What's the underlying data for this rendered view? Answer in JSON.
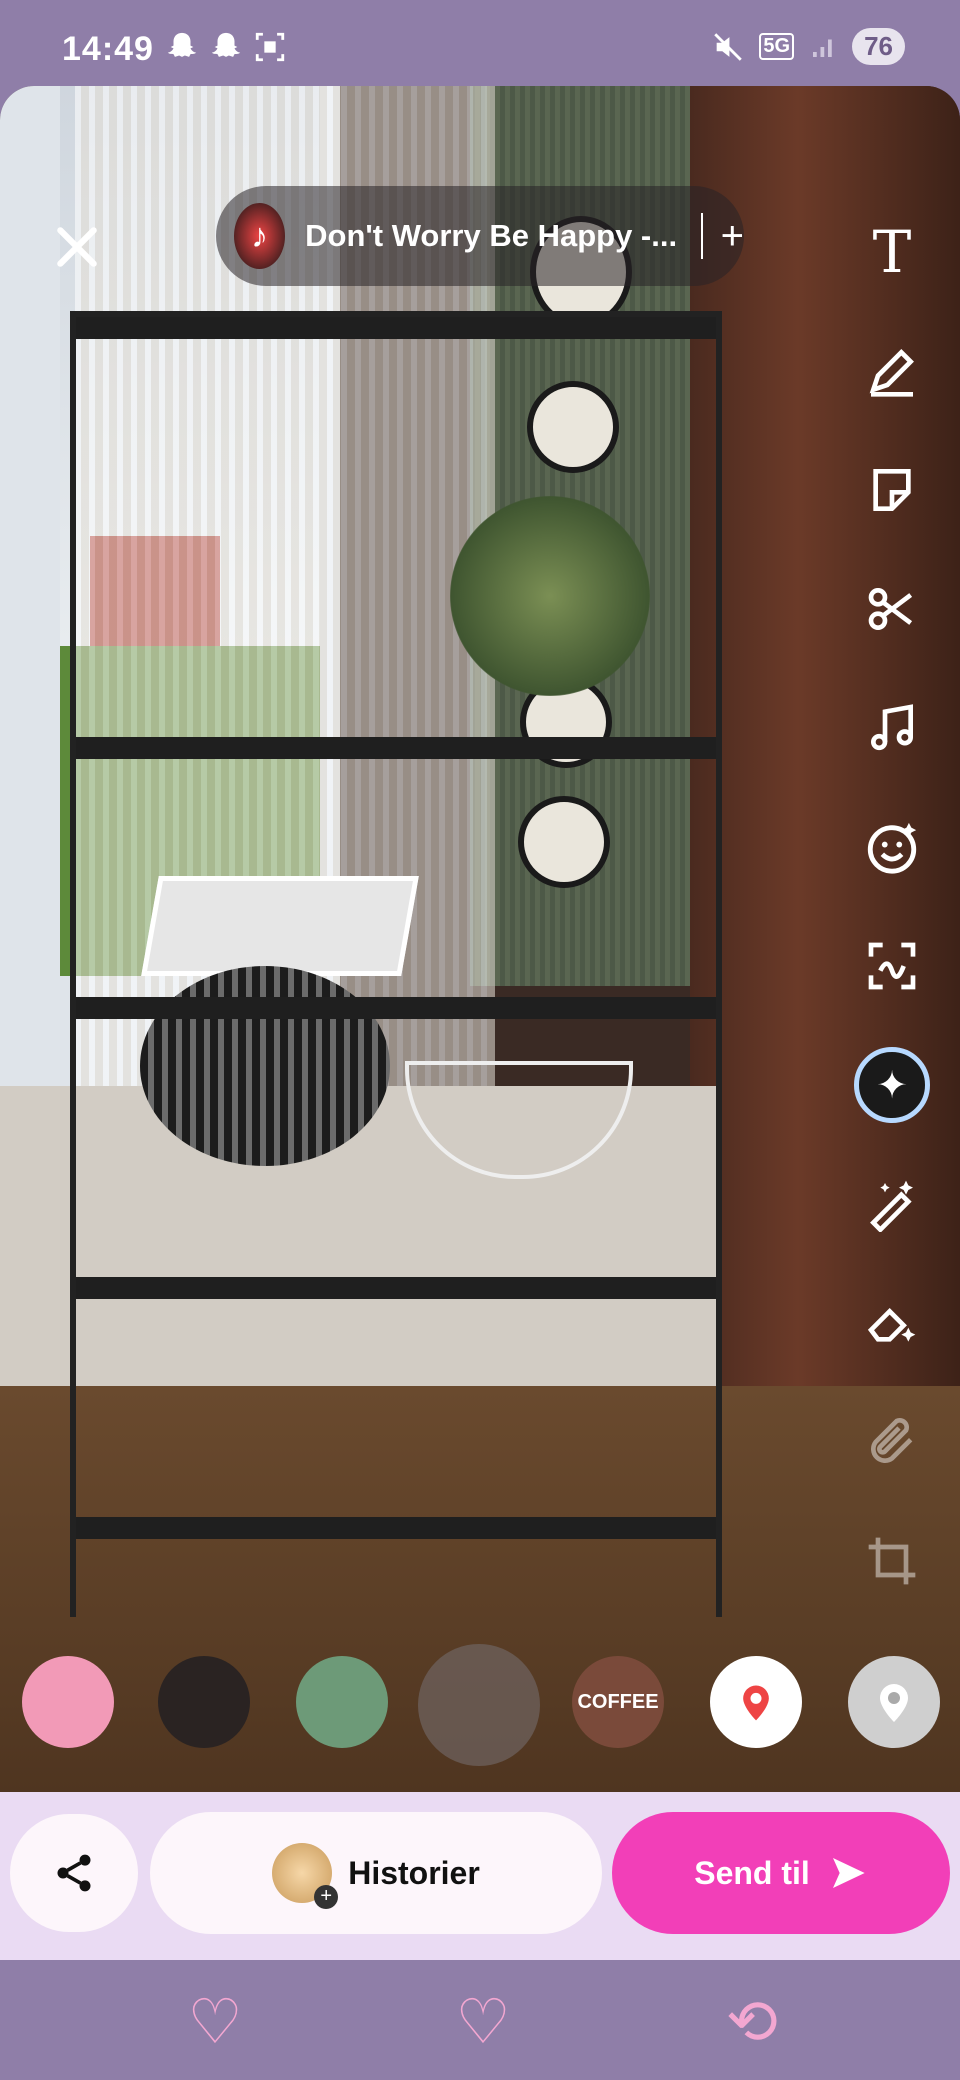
{
  "status_bar": {
    "time": "14:49",
    "left_icons": [
      "snapchat-ghost-icon",
      "snapchat-ghost-icon",
      "screenshot-icon"
    ],
    "right_icons": [
      "mute-icon",
      "5g-icon",
      "signal-icon"
    ],
    "battery": "76"
  },
  "editor": {
    "music": {
      "title": "Don't Worry Be Happy -...",
      "add": "+"
    },
    "close_icon": "close-icon",
    "tools": [
      "text-icon",
      "pen-icon",
      "sticker-icon",
      "scissors-icon",
      "music-icon",
      "lens-smiley-icon",
      "scan-icon",
      "ai-sparkle-icon",
      "magic-wand-icon",
      "eraser-sparkle-icon",
      "paperclip-icon",
      "crop-icon"
    ]
  },
  "lenses": {
    "items": [
      {
        "name": "pink-lens",
        "color": "#f29ab7",
        "label": ""
      },
      {
        "name": "dog-lens",
        "color": "#2a2322",
        "label": ""
      },
      {
        "name": "portrait-lens",
        "color": "#6d9a78",
        "label": ""
      },
      {
        "name": "blank-lens",
        "color": "#6e625d",
        "label": ""
      },
      {
        "name": "coffee-lens",
        "color": "#7a4a3a",
        "label": "COFFEE"
      },
      {
        "name": "pin-lens",
        "color": "#ffffff",
        "label": ""
      },
      {
        "name": "location-lens",
        "color": "#c9c9c9",
        "label": ""
      }
    ]
  },
  "bottom_bar": {
    "share_icon": "share-icon",
    "story_label": "Historier",
    "send_label": "Send til",
    "send_icon": "send-arrow-icon"
  },
  "colors": {
    "accent": "#f23fb8",
    "panel": "#eadbf3",
    "status_bar": "#8f7ea8"
  },
  "navigation": [
    "back-heart-icon",
    "home-heart-icon",
    "recents-icon"
  ]
}
